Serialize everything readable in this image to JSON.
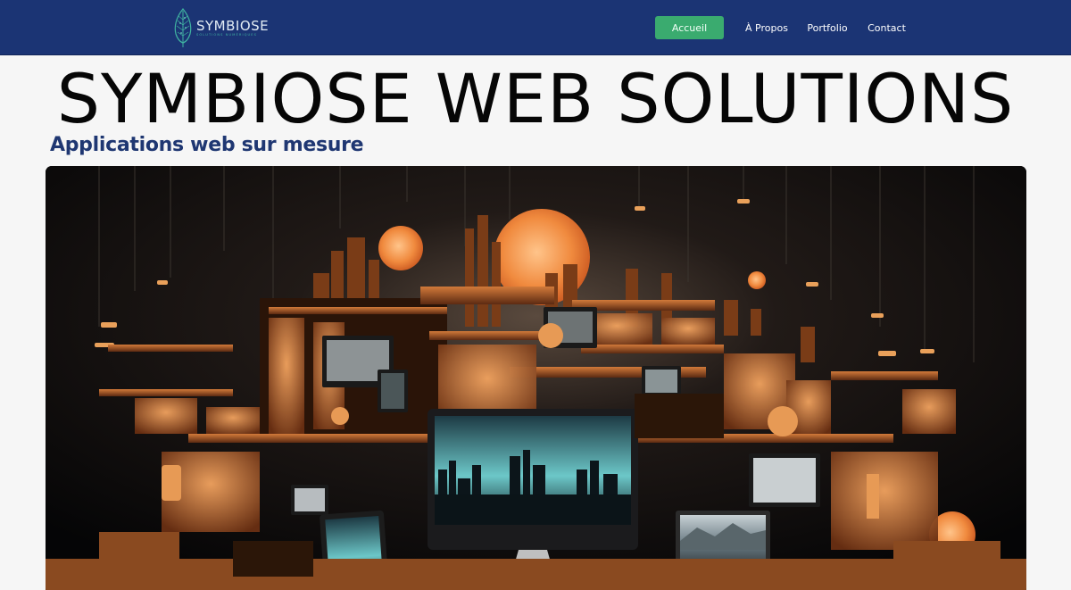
{
  "brand": {
    "name": "SYMBIOSE",
    "tagline": "SOLUTIONS NUMÉRIQUES",
    "icon": "leaf-icon"
  },
  "nav": {
    "items": [
      {
        "label": "Accueil",
        "active": true
      },
      {
        "label": "À Propos",
        "active": false
      },
      {
        "label": "Portfolio",
        "active": false
      },
      {
        "label": "Contact",
        "active": false
      }
    ]
  },
  "hero": {
    "title": "SYMBIOSE WEB SOLUTIONS",
    "subtitle": "Applications web sur mesure",
    "image": "hero-city-computers-illustration"
  },
  "colors": {
    "navbar": "#1b3474",
    "active_button": "#3aab6f",
    "subtitle": "#1f3772",
    "title": "#060606",
    "page_background": "#f6f6f6",
    "accent_orange": "#e8823a"
  }
}
